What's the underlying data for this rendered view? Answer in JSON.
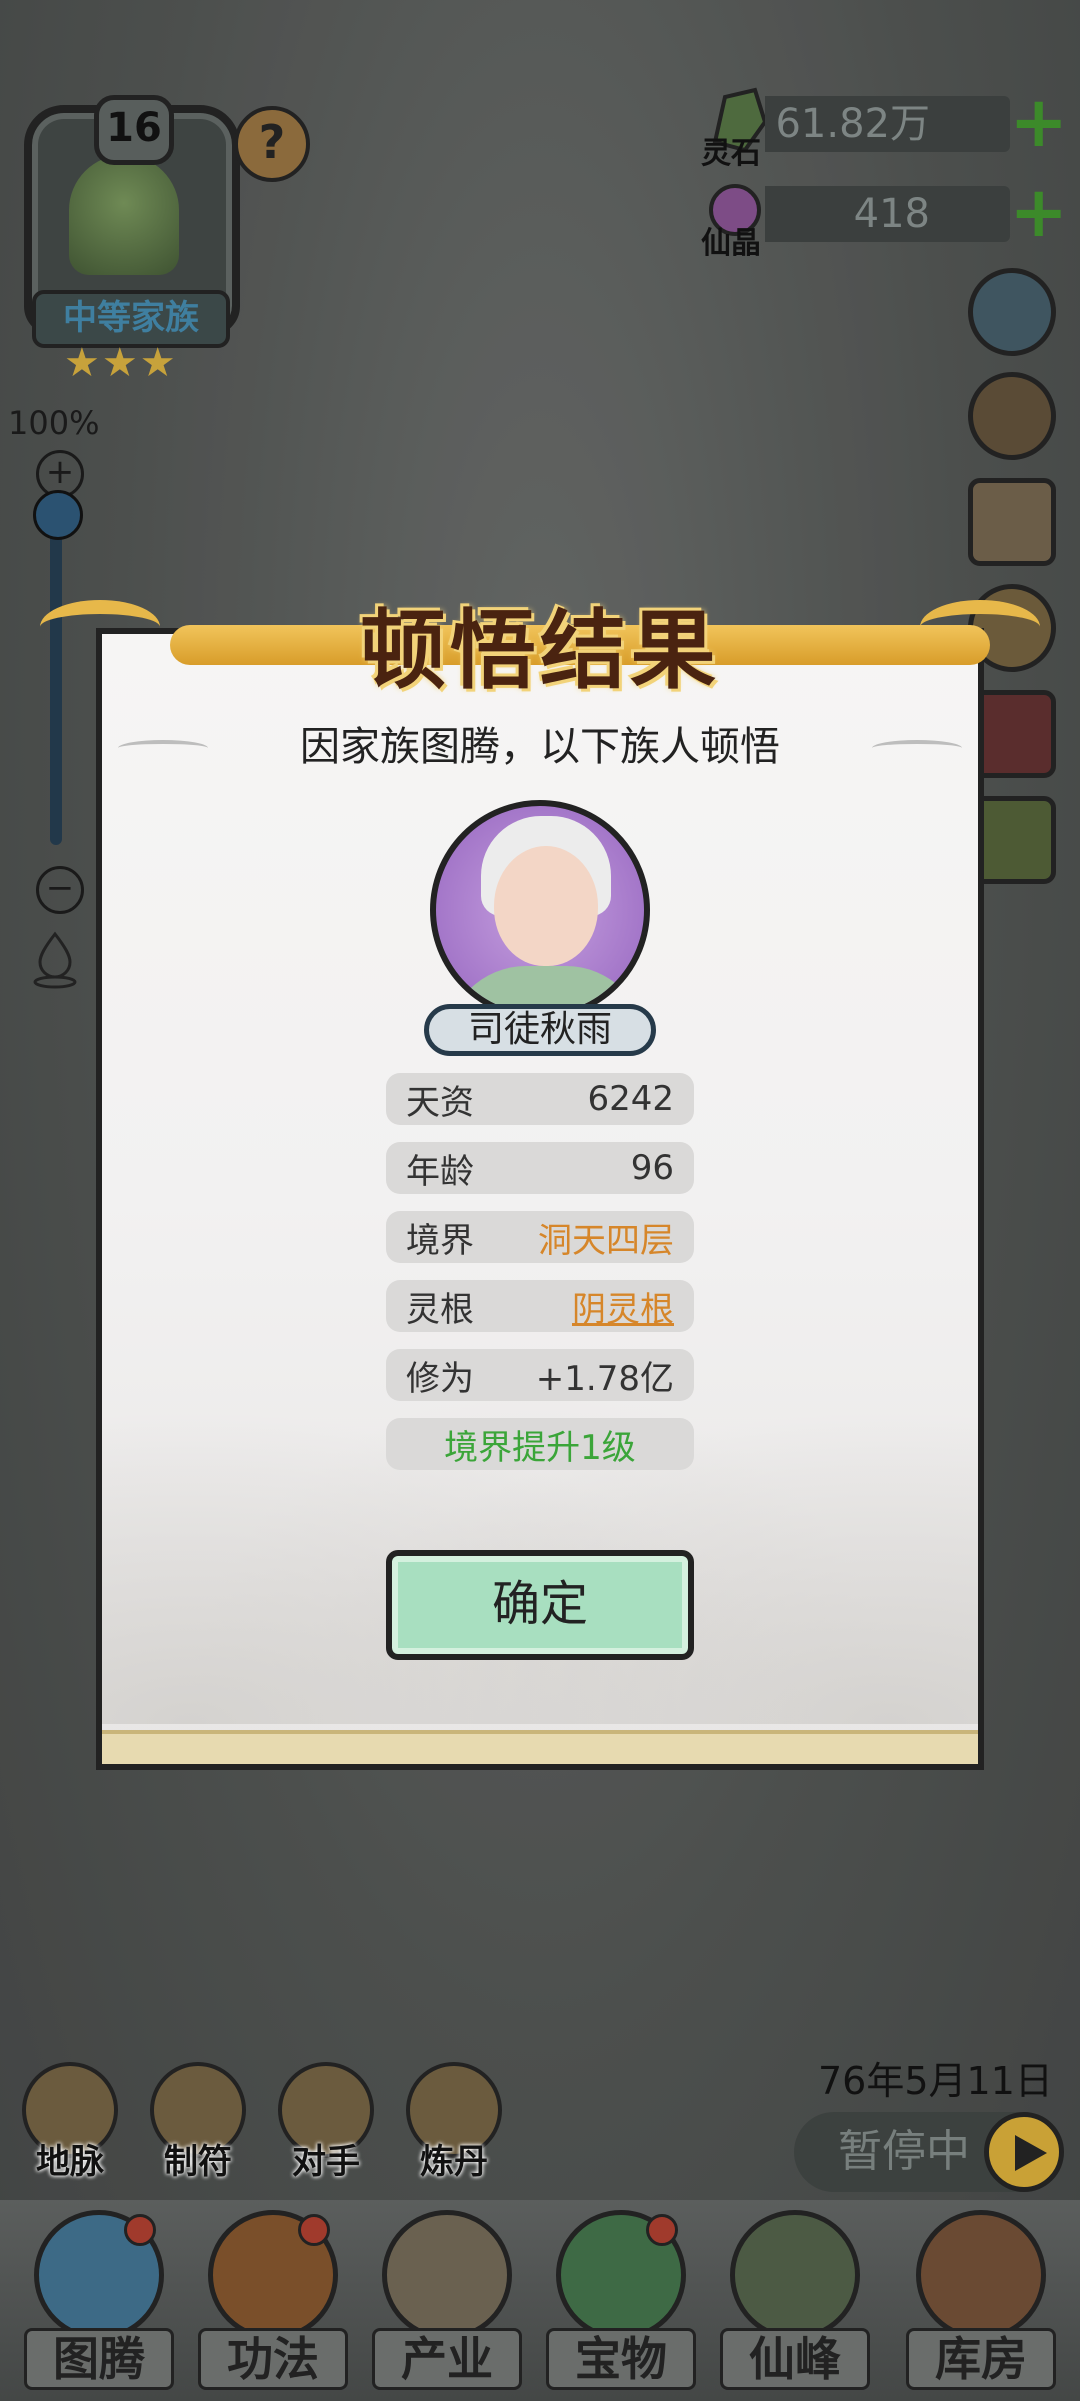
{
  "family": {
    "level": "16",
    "name": "中等家族",
    "stars": "★★★",
    "help": "?"
  },
  "zoom": {
    "percent": "100%",
    "plus": "+",
    "minus": "−"
  },
  "resources": [
    {
      "label": "灵石",
      "value": "61.82万",
      "plus": "+"
    },
    {
      "label": "仙晶",
      "value": "418",
      "plus": "+"
    }
  ],
  "dialog": {
    "title": "顿悟结果",
    "subtitle": "因家族图腾，以下族人顿悟",
    "character_name": "司徒秋雨",
    "stats": [
      {
        "label": "天资",
        "value": "6242"
      },
      {
        "label": "年龄",
        "value": "96"
      },
      {
        "label": "境界",
        "value": "洞天四层"
      },
      {
        "label": "灵根",
        "value": "阴灵根"
      },
      {
        "label": "修为",
        "value": "+1.78亿"
      }
    ],
    "result": "境界提升1级",
    "confirm": "确定",
    "colors": {
      "highlight": "#d6862a",
      "success": "#3ba539"
    }
  },
  "footer": {
    "date": "76年5月11日",
    "pause": "暂停中",
    "features": [
      "地脉",
      "制符",
      "对手",
      "炼丹"
    ],
    "nav": [
      "图腾",
      "功法",
      "产业",
      "宝物",
      "仙峰",
      "库房"
    ]
  }
}
